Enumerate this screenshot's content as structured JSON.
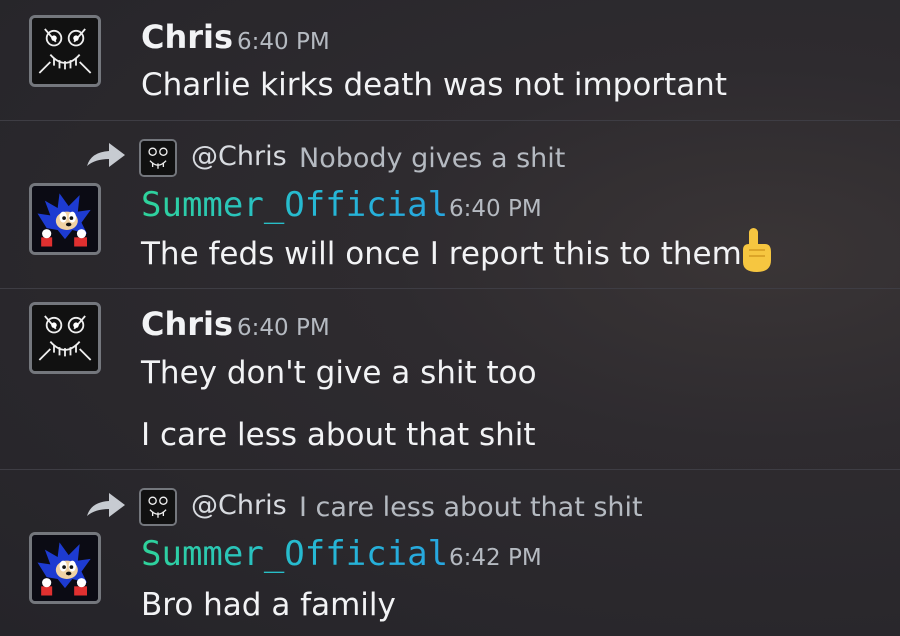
{
  "messages": [
    {
      "author": "Chris",
      "time": "6:40 PM",
      "lines": [
        "Charlie kirks death was not important"
      ]
    },
    {
      "reply_to": {
        "mention": "@Chris",
        "text": "Nobody gives a shit"
      },
      "author": "Summer_Official",
      "time": "6:40 PM",
      "lines": [
        "The feds will once I report this to them"
      ],
      "emoji": "index-pointing-up-icon"
    },
    {
      "author": "Chris",
      "time": "6:40 PM",
      "lines": [
        "They don't give a shit too",
        "I care less about that shit"
      ]
    },
    {
      "reply_to": {
        "mention": "@Chris",
        "text": "I care less about that shit"
      },
      "author": "Summer_Official",
      "time": "6:42 PM",
      "lines": [
        "Bro had a family"
      ]
    }
  ],
  "colors": {
    "background": "#2b292e",
    "summer_name_gradient": [
      "#2fd39a",
      "#27a6e0"
    ],
    "timestamp": "#b5bac1",
    "text": "#f2f3f5"
  }
}
